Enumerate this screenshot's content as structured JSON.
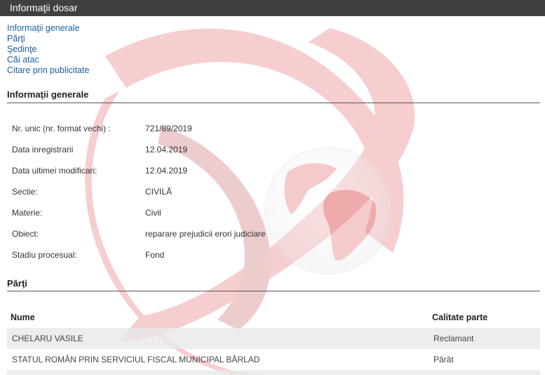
{
  "header": {
    "title": "Informaţii dosar"
  },
  "nav": {
    "items": [
      "Informaţii generale",
      "Părţi",
      "Şedinţe",
      "Căi atac",
      "Citare prin publicitate"
    ]
  },
  "general": {
    "title": "Informaţii generale",
    "rows": [
      {
        "label": "Nr. unic (nr. format vechi) :",
        "value": "721/89/2019"
      },
      {
        "label": "Data inregistrarii",
        "value": "12.04.2019"
      },
      {
        "label": "Data ultimei modificari:",
        "value": "12.04.2019"
      },
      {
        "label": "Sectie:",
        "value": "CIVILĂ"
      },
      {
        "label": "Materie:",
        "value": "Civil"
      },
      {
        "label": "Obiect:",
        "value": "reparare prejudicii erori judiciare"
      },
      {
        "label": "Stadiu procesual:",
        "value": "Fond"
      }
    ]
  },
  "parti": {
    "title": "Părţi",
    "headers": {
      "name": "Nume",
      "role": "Calitate parte"
    },
    "rows": [
      {
        "name": "CHELARU VASILE",
        "role": "Reclamant"
      },
      {
        "name": "STATUL ROMÂN PRIN SERVICIUL FISCAL MUNICIPAL BÂRLAD",
        "role": "Pârât"
      }
    ]
  }
}
